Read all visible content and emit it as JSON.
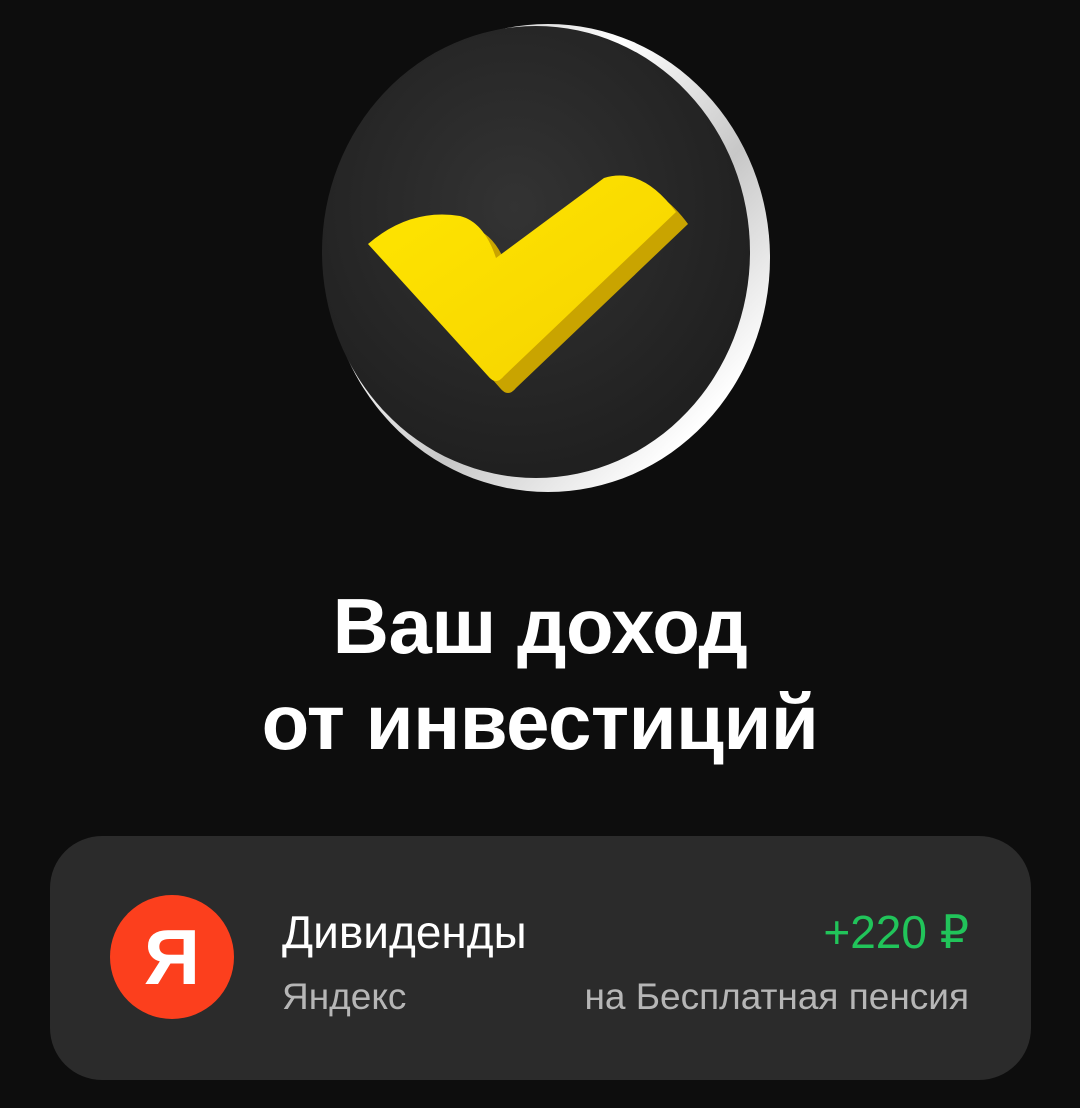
{
  "hero": {
    "icon": "yellow-checkmark-coin-icon",
    "colors": {
      "checkmark": "#ffdd00",
      "disc": "#2a2a2a",
      "rim": "#e8e8e8"
    }
  },
  "headline": {
    "line1": "Ваш доход",
    "line2": "от инвестиций"
  },
  "income_card": {
    "logo_letter": "Я",
    "logo_color": "#fc3f1d",
    "title": "Дивиденды",
    "company": "Яндекс",
    "amount": "+220 ₽",
    "amount_color": "#21c45a",
    "destination": "на Бесплатная пенсия"
  }
}
